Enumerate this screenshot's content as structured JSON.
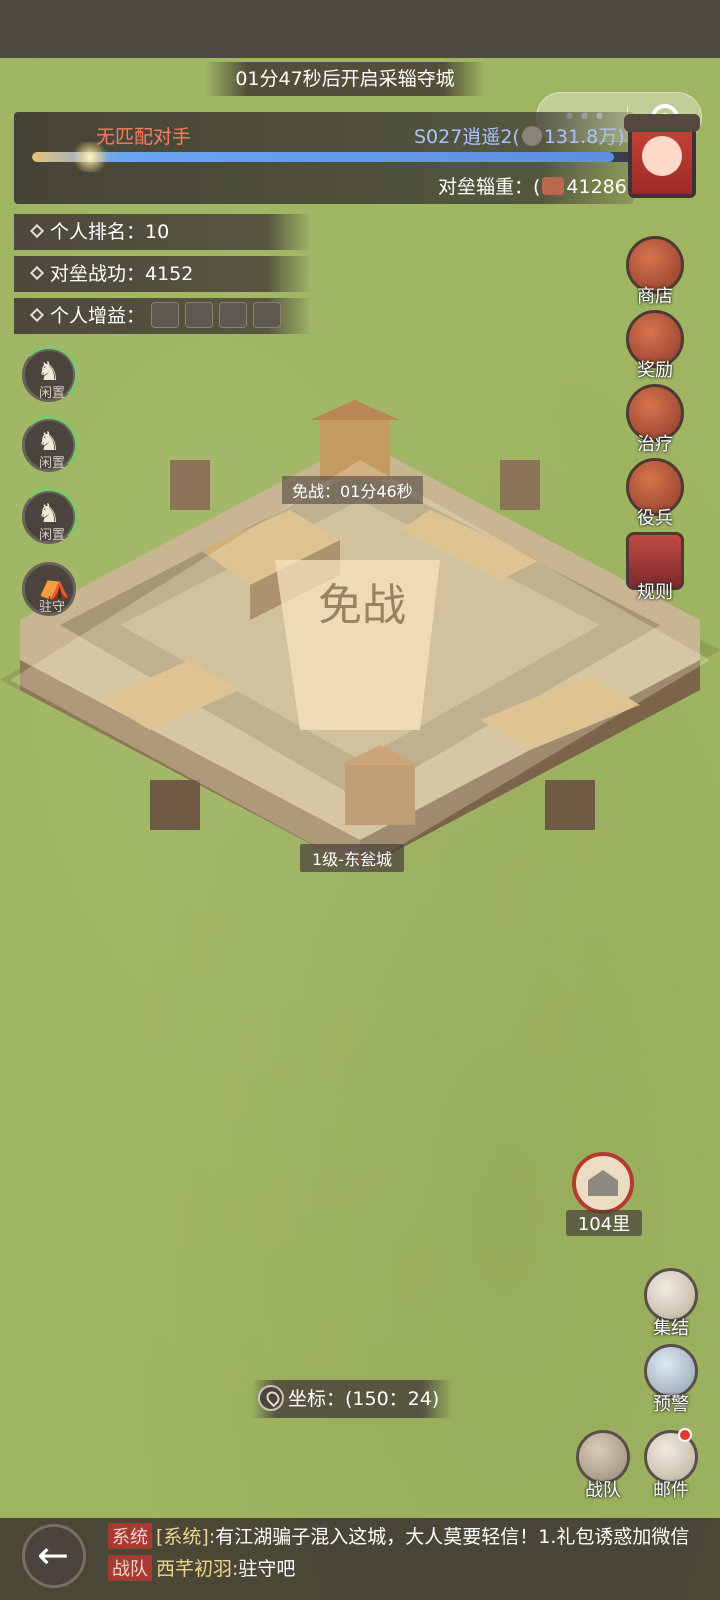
{
  "top_banner": {
    "text": "01分47秒后开启采辎夺城"
  },
  "match": {
    "label": "无匹配对手",
    "opponent_prefix": "S027逍遥2(",
    "opponent_power": "131.8万)",
    "progress": 0.97,
    "supply_label": "对垒辎重：(",
    "supply_value": "41286)"
  },
  "stats": {
    "rank": "个人排名：10",
    "merit": "对垒战功：4152",
    "buff": "个人增益："
  },
  "troops": [
    {
      "label": "闲置"
    },
    {
      "label": "闲置"
    },
    {
      "label": "闲置"
    },
    {
      "label": "驻守"
    }
  ],
  "side_menu": [
    {
      "label": "商店",
      "icon": "shop-icon"
    },
    {
      "label": "奖励",
      "icon": "reward-icon"
    },
    {
      "label": "治疗",
      "icon": "heal-icon"
    },
    {
      "label": "役兵",
      "icon": "conscript-icon"
    },
    {
      "label": "规则",
      "icon": "rules-icon"
    }
  ],
  "city": {
    "truce_timer": "免战：01分46秒",
    "truce_seal": "免战",
    "name": "1级-东瓮城"
  },
  "distance": {
    "label": "104里"
  },
  "coords": {
    "text": "坐标：(150：24)"
  },
  "bottom_buttons": [
    {
      "label": "集结",
      "icon": "rally-icon"
    },
    {
      "label": "预警",
      "icon": "alert-icon"
    },
    {
      "label": "战队",
      "icon": "team-icon"
    },
    {
      "label": "邮件",
      "icon": "mail-icon"
    }
  ],
  "chat": [
    {
      "tag": "系统",
      "prefix": "[系统]:",
      "body": "有江湖骗子混入这城，大人莫要轻信！1.礼包诱惑加微信"
    },
    {
      "tag": "战队",
      "prefix": "西芊初羽:",
      "body": "驻守吧"
    }
  ],
  "colors": {
    "grass": "#9fb561",
    "panel": "#463e38",
    "alert_red": "#ff7b62",
    "opponent_blue": "#a9c4ff"
  }
}
